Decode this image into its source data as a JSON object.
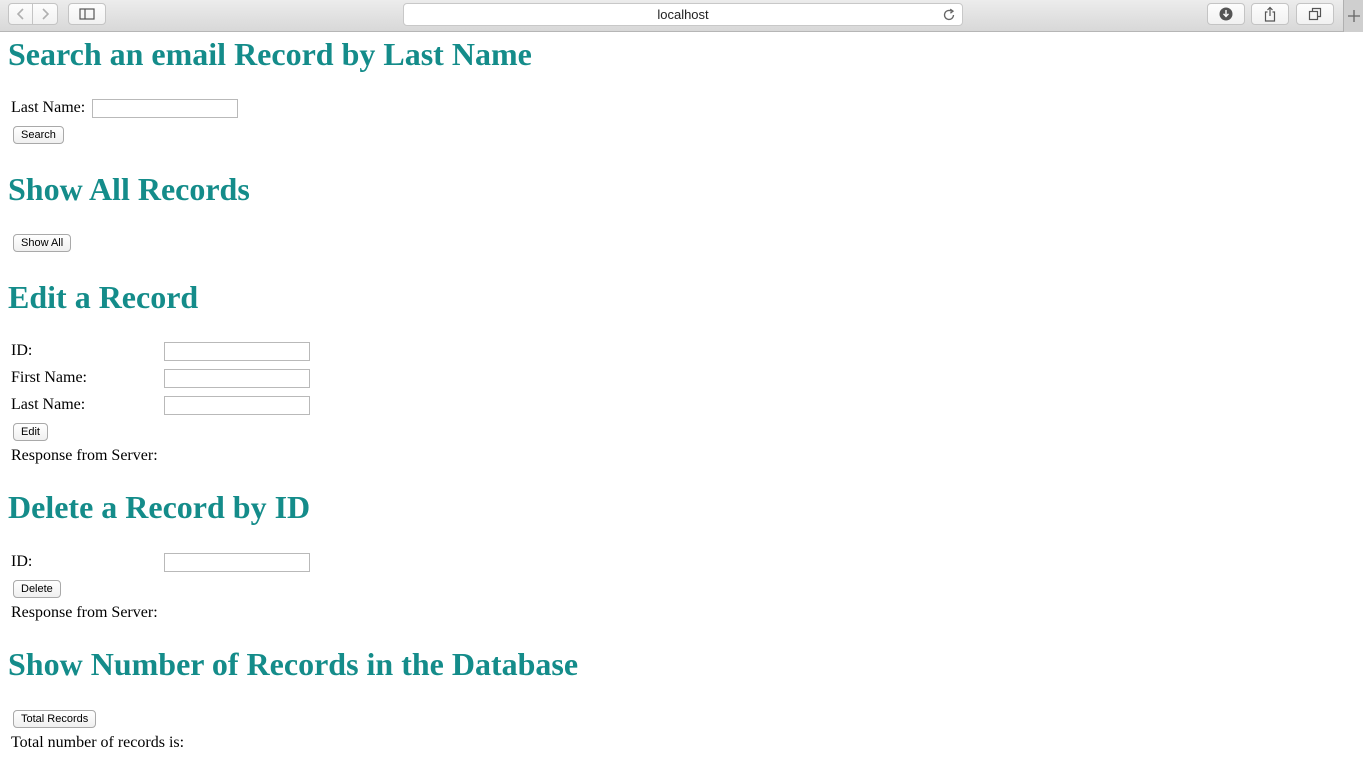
{
  "browser": {
    "address": "localhost",
    "icons": {
      "back": "chevron-left-icon",
      "forward": "chevron-right-icon",
      "sidebar": "sidebar-icon",
      "reload": "reload-icon",
      "download": "download-icon",
      "share": "share-icon",
      "tabs": "tabs-icon",
      "newtab": "plus-icon"
    }
  },
  "theme": {
    "heading_color": "#148c8a"
  },
  "search": {
    "heading": "Search an email Record by Last Name",
    "last_name_label": "Last Name:",
    "last_name_value": "",
    "button": "Search"
  },
  "show_all": {
    "heading": "Show All Records",
    "button": "Show All"
  },
  "edit": {
    "heading": "Edit a Record",
    "id_label": "ID:",
    "id_value": "",
    "first_name_label": "First Name:",
    "first_name_value": "",
    "last_name_label": "Last Name:",
    "last_name_value": "",
    "button": "Edit",
    "response_label": "Response from Server:"
  },
  "delete": {
    "heading": "Delete a Record by ID",
    "id_label": "ID:",
    "id_value": "",
    "button": "Delete",
    "response_label": "Response from Server:"
  },
  "count": {
    "heading": "Show Number of Records in the Database",
    "button": "Total Records",
    "result_label": "Total number of records is:"
  }
}
